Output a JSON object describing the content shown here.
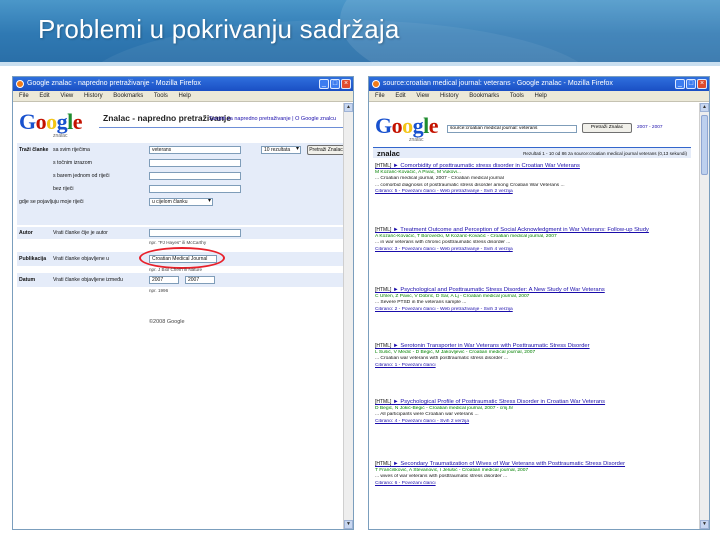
{
  "slide": {
    "title": "Problemi u pokrivanju sadržaja"
  },
  "left_window": {
    "title": "Google znalac - napredno pretraživanje - Mozilla Firefox",
    "menu": [
      "File",
      "Edit",
      "View",
      "History",
      "Bookmarks",
      "Tools",
      "Help"
    ],
    "logo": {
      "subtitle": "znalac"
    },
    "heading": "Znalac - napredno pretraživanje",
    "help_link": "Savjeti za napredno pretraživanje | O Google znalcu",
    "search_section_label": "Traži članke",
    "rows": [
      {
        "label": "sa svim riječima",
        "value": "veterans"
      },
      {
        "label": "s točnim izrazom",
        "value": ""
      },
      {
        "label": "s barem jednom od riječi",
        "value": ""
      },
      {
        "label": "bez riječi",
        "value": ""
      },
      {
        "label": "gdje se pojavljuju moje riječi",
        "value": ""
      }
    ],
    "results_select": "10 rezultata",
    "search_button": "Pretraži Znalac",
    "where_select": "u cijelom članku",
    "author": {
      "label": "Autor",
      "desc": "Vrati članke čije je autor",
      "hint": "npr. \"PJ Hayes\" ili McCarthy"
    },
    "publication": {
      "label": "Publikacija",
      "desc": "Vrati članke objavljene u",
      "value": "Croatian Medical Journal",
      "hint": "npr. J Biol Chem ili Nature"
    },
    "date": {
      "label": "Datum",
      "desc": "Vrati članke objavljene između",
      "from": "2007",
      "to": "2007",
      "hint": "npr. 1996"
    },
    "copyright": "©2008 Google"
  },
  "right_window": {
    "title": "source:croatian medical journal: veterans - Google znalac - Mozilla Firefox",
    "menu": [
      "File",
      "Edit",
      "View",
      "History",
      "Bookmarks",
      "Tools",
      "Help"
    ],
    "logo": {
      "subtitle": "znalac"
    },
    "search_value": "source:croatian medical journal: veterans",
    "search_button": "Pretraži Znalac",
    "search_extra": "2007 - 2007",
    "results_label": "znalac",
    "results_stats": "Rezultati 1 - 10 od 86 za source:croatian medical journal veterans (0,13 sekundi)",
    "results": [
      {
        "tag": "[HTML]",
        "title": "Comorbidity of posttraumatic stress disorder in Croatian War Veterans",
        "lines": [
          "M Kozarić-Kovačić, A Pivac, M Vukovi...",
          "... Croatian medical journal, 2007 - Croatian medical journal",
          "... comorbid diagnosis of posttraumatic stress disorder among Croatian War Veterans ...",
          "Citirano: 5 - Povezani članci - Web pretraživanje - Svih 2 verzija"
        ]
      },
      {
        "tag": "[HTML]",
        "title": "Treatment Outcome and Perception of Social Acknowledgment in War Veterans: Follow-up Study",
        "lines": [
          "A Kozarić-Kovačić, T Borovečki, M Kozarić-Kovačić - Croatian medical journal, 2007",
          "... in war veterans with chronic posttraumatic stress disorder ...",
          "Citirano: 3 - Povezani članci - Web pretraživanje - Svih 4 verzija"
        ]
      },
      {
        "tag": "[HTML]",
        "title": "Psychological and Posttraumatic Stress Disorder: A New Study of War Veterans",
        "lines": [
          "C Uhlen, Z Pavic, V Dobrić, D Šar, A Lj - Croatian medical journal, 2007",
          "... Severe PTSD in the veterans sample ...",
          "Citirano: 2 - Povezani članci - Web pretraživanje - Svih 3 verzija"
        ]
      },
      {
        "tag": "[HTML]",
        "title": "Serotonin Transporter in War Veterans with Posttraumatic Stress Disorder",
        "lines": [
          "L Sušić, V Medić - D Begić, M Jakovljević - Croatian medical journal, 2007",
          "... Croatian war veterans with posttraumatic stress disorder ...",
          "Citirano: 1 - Povezani članci"
        ]
      },
      {
        "tag": "[HTML]",
        "title": "Psychological Profile of Posttraumatic Stress Disorder in Croatian War Veterans",
        "lines": [
          "D Begić, N Jokić-Begić - Croatian medical journal, 2007 - cmj.hr",
          "... All participants were Croatian war veterans ...",
          "Citirano: 4 - Povezani članci - Svih 2 verzija"
        ]
      },
      {
        "tag": "[HTML]",
        "title": "Secondary Traumatization of Wives of War Veterans with Posttraumatic Stress Disorder",
        "lines": [
          "T Frančišković, A Stevanović, I Jelušić - Croatian medical journal, 2007",
          "... wives of war veterans with posttraumatic stress disorder ...",
          "Citirano: 6 - Povezani članci"
        ]
      }
    ]
  },
  "colors": {
    "title_band": "#2f79b3",
    "window_titlebar": "#1a4fc4",
    "link": "#1a0dab",
    "highlight_oval": "#e8202a",
    "form_band": "#e5ecf9"
  }
}
